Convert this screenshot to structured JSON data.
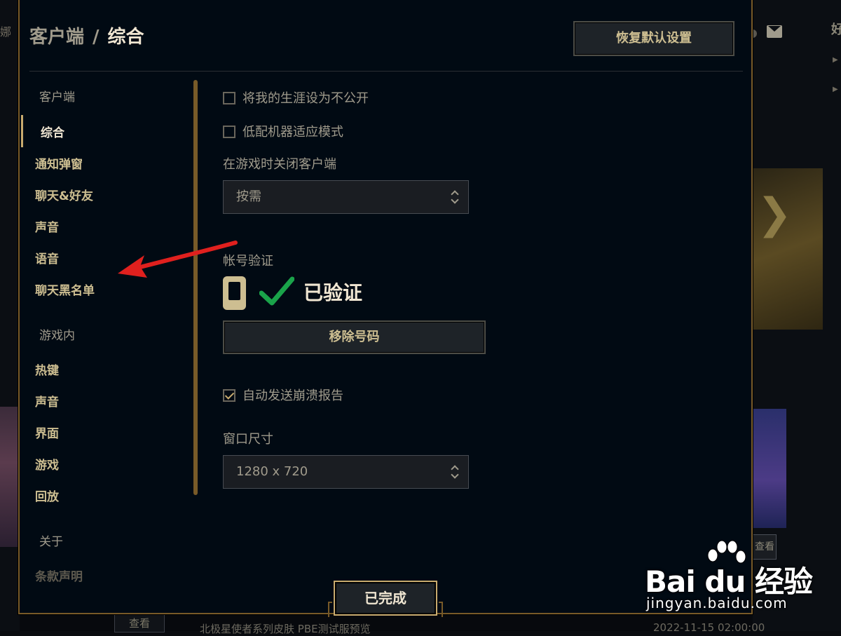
{
  "header": {
    "section": "客户端",
    "separator": "/",
    "current": "综合",
    "reset_button": "恢复默认设置"
  },
  "nav": {
    "client_section": "客户端",
    "client_items": [
      "综合",
      "通知弹窗",
      "聊天&好友",
      "声音",
      "语音",
      "聊天黑名单"
    ],
    "ingame_section": "游戏内",
    "ingame_items": [
      "热键",
      "声音",
      "界面",
      "游戏",
      "回放"
    ],
    "about_section": "关于",
    "about_items": [
      "条款声明"
    ],
    "active": "综合"
  },
  "settings": {
    "private_career": {
      "label": "将我的生涯设为不公开",
      "checked": false
    },
    "low_spec_mode": {
      "label": "低配机器适应模式",
      "checked": false
    },
    "close_client_label": "在游戏时关闭客户端",
    "close_client_value": "按需",
    "account_verify_label": "帐号验证",
    "verified_text": "已验证",
    "remove_number_button": "移除号码",
    "crash_report": {
      "label": "自动发送崩溃报告",
      "checked": true
    },
    "window_size_label": "窗口尺寸",
    "window_size_value": "1280 x 720"
  },
  "footer": {
    "done_button": "已完成"
  },
  "background": {
    "left_fragment": "娜",
    "right_letter": "好",
    "view_button": "查看",
    "news_text": "北极星使者系列皮肤 PBE测试服预览",
    "news_date": "2022-11-15 02:00:00"
  },
  "watermark": {
    "logo": "Bai du 经验",
    "url": "jingyan.baidu.com"
  },
  "colors": {
    "gold": "#c8aa6e",
    "gold_dark": "#785a28",
    "text": "#a09b8c",
    "text_bright": "#f0e6d2",
    "check_green": "#1aa34a",
    "annotation_arrow": "#e0201e"
  }
}
